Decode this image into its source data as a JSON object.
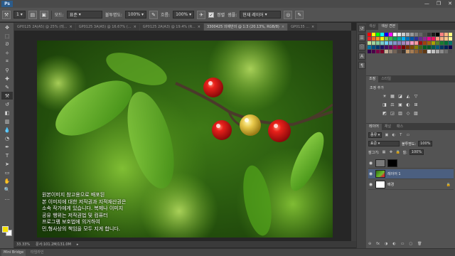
{
  "app": {
    "logo": "Ps",
    "window_controls": [
      "—",
      "❐",
      "✕"
    ]
  },
  "options_bar": {
    "brush_size": "1",
    "mode_label": "모드:",
    "mode_value": "표준",
    "opacity_label": "불투명도:",
    "opacity_value": "100%",
    "flow_label": "흐름:",
    "flow_value": "100%",
    "aligned_label": "정렬",
    "sample_label": "샘플:",
    "sample_value": "현재 레이어"
  },
  "document_tabs": [
    {
      "label": "GP0125 2A(A5) @ 25% (레...",
      "active": false
    },
    {
      "label": "GP0125 3A(A5) @ 16.67% (...",
      "active": false
    },
    {
      "label": "GP0125 2A(A3) @ 19.4% (R...",
      "active": false
    },
    {
      "label": "3300425 의제반의 @ 1:3 (20.13%, RGB/8)",
      "active": true
    },
    {
      "label": "GP0135 ...",
      "active": false
    }
  ],
  "canvas": {
    "caption_lines": [
      "원본이미지 참고용으로 배포된",
      "본 이미지에 대한 저작권과 지적재산권은",
      "소속 작가에게 있습니다. 복제나 이미지",
      "공유 행위는 저작권법 및 컴퓨터",
      "프로그램 보호법에 의거하여",
      "민,형사상의 책임을 모두 지게 합니다."
    ]
  },
  "status_bar": {
    "zoom": "33.33%",
    "doc_info": "문서:101.2M/131.0M"
  },
  "bottom_bar": {
    "tabs": [
      "Mini Bridge",
      "타임라인"
    ]
  },
  "panels": {
    "swatch_tabs": [
      "색상",
      "색상 견본"
    ],
    "swatch_colors": [
      "#ff0000",
      "#ffff00",
      "#00ff00",
      "#00ffff",
      "#0000ff",
      "#ff00ff",
      "#ffffff",
      "#e6e6e6",
      "#cccccc",
      "#b3b3b3",
      "#999999",
      "#808080",
      "#666666",
      "#4d4d4d",
      "#333333",
      "#1a1a1a",
      "#000000",
      "#ff8080",
      "#ffb380",
      "#ffff80",
      "#ed1c24",
      "#f26522",
      "#f7941d",
      "#fff200",
      "#8dc63f",
      "#39b54a",
      "#00a651",
      "#00a99d",
      "#00aeef",
      "#0072bc",
      "#0054a6",
      "#2e3192",
      "#662d91",
      "#92278f",
      "#ec008c",
      "#ed145b",
      "#f69679",
      "#f9ad81",
      "#fdc68a",
      "#fff799",
      "#c4df9b",
      "#a3d39c",
      "#82ca9c",
      "#7accc8",
      "#6dcff6",
      "#7da7d9",
      "#8393ca",
      "#8781bd",
      "#a186be",
      "#bd8cbf",
      "#f49ac1",
      "#f6989d",
      "#9e0b0f",
      "#a0410d",
      "#a3620a",
      "#aba000",
      "#598527",
      "#1a7b30",
      "#007236",
      "#00746b",
      "#0076a3",
      "#004b80",
      "#003471",
      "#1b1464",
      "#440e62",
      "#630460",
      "#9e005d",
      "#9e0039",
      "#790000",
      "#7b2e00",
      "#7d4900",
      "#827b00",
      "#406618",
      "#005e20",
      "#005826",
      "#005952",
      "#005b7f",
      "#003663",
      "#002157",
      "#0d004c",
      "#32004b",
      "#4b0049",
      "#7b0046",
      "#7a0026",
      "#c7b299",
      "#998675",
      "#736357",
      "#534741",
      "#37302a",
      "#c69c6d",
      "#a67c52",
      "#8c6239",
      "#754c24",
      "#603913",
      "#dcdcdc",
      "#c0c0c0",
      "#a9a9a9",
      "#8a8a8a",
      "#6e6e6e",
      "#505050"
    ],
    "adjust_tabs": [
      "조정",
      "스타일"
    ],
    "adjust_title": "조정 추가",
    "adjust_rows": [
      [
        "☀",
        "▦",
        "◪",
        "◭",
        "▽"
      ],
      [
        "◨",
        "⚖",
        "▣",
        "◐",
        "⊞"
      ],
      [
        "◩",
        "◲",
        "▥",
        "◇",
        "▨"
      ]
    ],
    "layers_tabs": [
      "레이어",
      "채널",
      "패스"
    ],
    "layer_kind": "종류",
    "blend_mode": "표준",
    "opacity_label": "불투명도:",
    "opacity_value": "100%",
    "lock_label": "잠그기:",
    "fill_label": "칠:",
    "fill_value": "100%",
    "layers": [
      {
        "name": "",
        "kind": "mask",
        "visible": true,
        "selected": false
      },
      {
        "name": "레이어 1",
        "kind": "photo",
        "visible": true,
        "selected": true
      },
      {
        "name": "배경",
        "kind": "white",
        "visible": true,
        "selected": false
      }
    ],
    "layer_footer_icons": [
      "⊖",
      "fx",
      "◑",
      "◐",
      "▭",
      "▢",
      "🗑"
    ]
  }
}
